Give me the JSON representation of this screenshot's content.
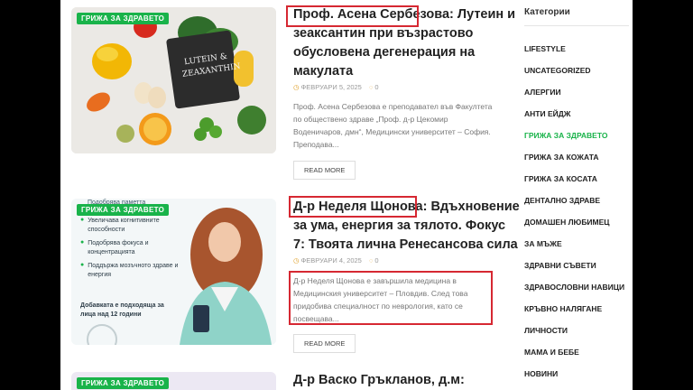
{
  "posts": [
    {
      "badge": "ГРИЖА ЗА ЗДРАВЕТО",
      "title_l1_part1": "Проф. Асена Сербезова:",
      "title_l1_part2": " Лутеин и",
      "title_l2": "зеаксантин при възрастово",
      "title_l3": "обусловена дегенерация на",
      "title_l4": "макулата",
      "date": "ФЕВРУАРИ 5, 2025",
      "comments": "0",
      "excerpt": "Проф. Асена Сербезова е преподавател във Факултета по обществено здраве „Проф. д-р Цекомир Воденичаров, дмн“, Медицински университет – София. Преподава...",
      "read_more": "READ MORE",
      "image_text": "LUTEIN & ZEAXANTHIN"
    },
    {
      "badge": "ГРИЖА ЗА ЗДРАВЕТО",
      "title_l1_part1": "Д-р Неделя Щонова:",
      "title_l1_part2": " Вдъхновение",
      "title_l2": "за ума, енергия за тялото. Фокус",
      "title_l3": "7: Твоята лична Ренесансова сила",
      "date": "ФЕВРУАРИ 4, 2025",
      "comments": "0",
      "excerpt": "Д-р Неделя Щонова е завършила медицина в Медицинския университет – Пловдив. След това придобива специалност по неврология, като се посвещава...",
      "read_more": "READ MORE",
      "ad_top": "Подобрява паметта",
      "ad_items": [
        "Увеличава когнитивните способности",
        "Подобрява фокуса и концентрацията",
        "Поддържа мозъчното здраве и енергия"
      ],
      "ad_note": "Добавката е подходяща за лица над 12 години"
    },
    {
      "badge": "ГРИЖА ЗА ЗДРАВЕТО",
      "title_l1": "Д-р Васко Гръкланов, д.м:"
    }
  ],
  "sidebar": {
    "title": "Категории",
    "categories": [
      "LIFESTYLE",
      "UNCATEGORIZED",
      "АЛЕРГИИ",
      "АНТИ ЕЙДЖ",
      "ГРИЖА ЗА ЗДРАВЕТО",
      "ГРИЖА ЗА КОЖАТА",
      "ГРИЖА ЗА КОСАТА",
      "ДЕНТАЛНО ЗДРАВЕ",
      "ДОМАШЕН ЛЮБИМЕЦ",
      "ЗА МЪЖЕ",
      "ЗДРАВНИ СЪВЕТИ",
      "ЗДРАВОСЛОВНИ НАВИЦИ",
      "КРЪВНО НАЛЯГАНЕ",
      "ЛИЧНОСТИ",
      "МАМА И БЕБЕ",
      "НОВИНИ"
    ],
    "active_index": 4
  },
  "colors": {
    "accent": "#19b34a",
    "highlight": "#d62832",
    "date_icon": "#e0a12b"
  }
}
